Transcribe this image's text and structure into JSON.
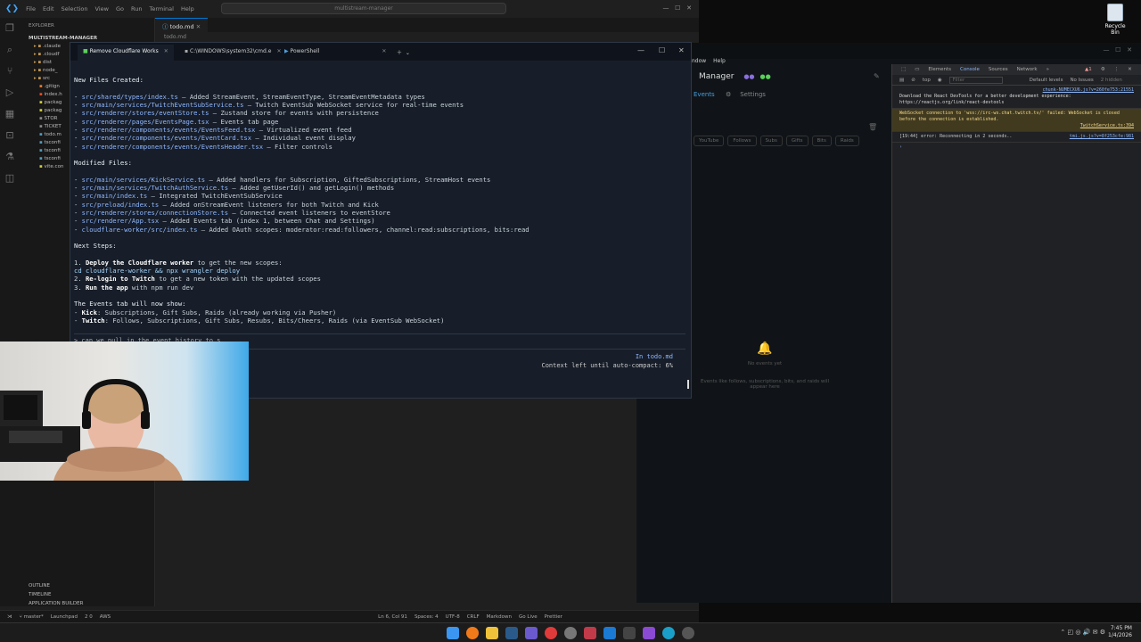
{
  "vscode": {
    "menu": [
      "File",
      "Edit",
      "Selection",
      "View",
      "Go",
      "Run",
      "Terminal",
      "Help"
    ],
    "search": "multistream-manager",
    "explorer_header": "EXPLORER",
    "project": "MULTISTREAM-MANAGER",
    "tree": [
      ".claude",
      ".cloudf",
      "dist",
      "node_",
      "src",
      ".gitign",
      "index.h",
      "packag",
      "packag",
      "STOR",
      "TICKET",
      "todo.m",
      "tsconfi",
      "tsconfi",
      "tsconfi",
      "vite.con"
    ],
    "tab": "todo.md",
    "breadcrumb": "todo.md",
    "bottom_sections": [
      "OUTLINE",
      "TIMELINE",
      "APPLICATION BUILDER"
    ],
    "status": {
      "branch": "master*",
      "launchpad": "Launchpad",
      "problems": "2 0",
      "aws": "AWS",
      "position": "Ln 6, Col 91",
      "spaces": "Spaces: 4",
      "encoding": "UTF-8",
      "eol": "CRLF",
      "language": "Markdown",
      "golive": "Go Live",
      "prettier": "Prettier"
    }
  },
  "terminal": {
    "tabs": [
      "Remove Cloudflare Works",
      "C:\\WINDOWS\\system32\\cmd.e",
      "PowerShell"
    ],
    "new_files_title": "New Files Created:",
    "new_files": [
      {
        "path": "src/shared/types/index.ts",
        "desc": " – Added StreamEvent, StreamEventType, StreamEventMetadata types"
      },
      {
        "path": "src/main/services/TwitchEventSubService.ts",
        "desc": " – Twitch EventSub WebSocket service for real-time events"
      },
      {
        "path": "src/renderer/stores/eventStore.ts",
        "desc": " – Zustand store for events with persistence"
      },
      {
        "path": "src/renderer/pages/EventsPage.tsx",
        "desc": " – Events tab page"
      },
      {
        "path": "src/renderer/components/events/EventsFeed.tsx",
        "desc": " – Virtualized event feed"
      },
      {
        "path": "src/renderer/components/events/EventCard.tsx",
        "desc": " – Individual event display"
      },
      {
        "path": "src/renderer/components/events/EventsHeader.tsx",
        "desc": " – Filter controls"
      }
    ],
    "modified_title": "Modified Files:",
    "modified_files": [
      {
        "path": "src/main/services/KickService.ts",
        "desc": " – Added handlers for Subscription, GiftedSubscriptions, StreamHost events"
      },
      {
        "path": "src/main/services/TwitchAuthService.ts",
        "desc": " – Added getUserId() and getLogin() methods"
      },
      {
        "path": "src/main/index.ts",
        "desc": " – Integrated TwitchEventSubService"
      },
      {
        "path": "src/preload/index.ts",
        "desc": " – Added onStreamEvent listeners for both Twitch and Kick"
      },
      {
        "path": "src/renderer/stores/connectionStore.ts",
        "desc": " – Connected event listeners to eventStore"
      },
      {
        "path": "src/renderer/App.tsx",
        "desc": " – Added Events tab (index 1, between Chat and Settings)"
      },
      {
        "path": "cloudflare-worker/src/index.ts",
        "desc": " – Added OAuth scopes: moderator:read:followers, channel:read:subscriptions, bits:read"
      }
    ],
    "next_title": "Next Steps:",
    "step1_a": "1. ",
    "step1_b": "Deploy the Cloudflare worker",
    "step1_c": " to get the new scopes:",
    "step1_cmd": "cd cloudflare-worker && npx wrangler deploy",
    "step2_a": "2. ",
    "step2_b": "Re-login to Twitch",
    "step2_c": " to get a new token with the updated scopes",
    "step3_a": "3. ",
    "step3_b": "Run the app",
    "step3_c": " with npm run dev",
    "events_title": "The Events tab will now show:",
    "kick_a": "- ",
    "kick_b": "Kick",
    "kick_c": ": Subscriptions, Gift Subs, Raids (already working via Pusher)",
    "twitch_a": "- ",
    "twitch_b": "Twitch",
    "twitch_c": ": Follows, Subscriptions, Gift Subs, Resubs, Bits/Cheers, Raids (via EventSub WebSocket)",
    "prompt": "> can we pull in the event history to s",
    "in_file": "In todo.md",
    "context": "Context left until auto-compact: 6%"
  },
  "app": {
    "menu": [
      "ndow",
      "Help"
    ],
    "title": "Manager",
    "tabs": [
      "Events",
      "Settings"
    ],
    "filters": [
      "YouTube",
      "Follows",
      "Subs",
      "Gifts",
      "Bits",
      "Raids"
    ],
    "empty_title": "No events yet",
    "empty_desc": "Events like follows, subscriptions, bits, and raids will appear here"
  },
  "devtools": {
    "tabs": [
      "Elements",
      "Console",
      "Sources",
      "Network"
    ],
    "context": "top",
    "filter": "Filter",
    "levels": "Default levels",
    "issues": "No Issues",
    "hidden": "2 hidden",
    "msg1_src": "chunk-NUMECXU6.js?v=260fe753:21551",
    "msg1": "Download the React DevTools for a better development experience: https://reactjs.org/link/react-devtools",
    "msg2": "WebSocket connection to 'wss://irc-ws.chat.twitch.tv/' failed: WebSocket is closed before the connection is established.",
    "msg2_src": "TwitchService.ts:394",
    "msg3": "[19:44] error: Reconnecting in 2 seconds..",
    "msg3_src": "tmi.js.js?v=8f253cfe:981"
  },
  "desktop": {
    "recycle": "Recycle Bin"
  },
  "taskbar": {
    "time": "7:45 PM",
    "date": "1/4/2026"
  }
}
